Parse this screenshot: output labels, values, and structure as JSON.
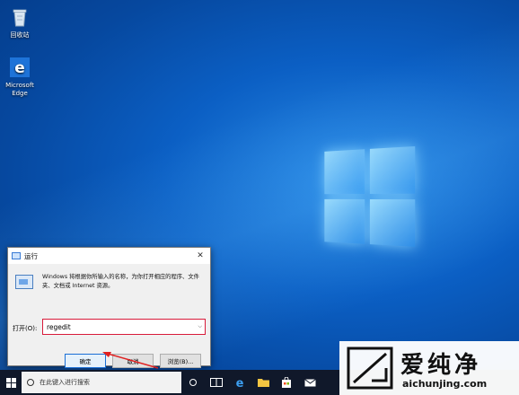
{
  "desktop": {
    "icons": [
      {
        "label": "回收站",
        "icon": "recycle-bin-icon"
      },
      {
        "label": "Microsoft Edge",
        "icon": "edge-icon"
      }
    ]
  },
  "run_dialog": {
    "title": "运行",
    "description": "Windows 将根据你所输入的名称，为你打开相应的程序、文件夹、文档或 Internet 资源。",
    "open_label": "打开(O):",
    "input_value": "regedit",
    "ok_label": "确定",
    "cancel_label": "取消",
    "browse_label": "浏览(B)..."
  },
  "taskbar": {
    "search_placeholder": "在此键入进行搜索"
  },
  "watermark": {
    "title": "爱纯净",
    "url": "aichunjing.com"
  },
  "colors": {
    "highlight": "#d81b3a",
    "accent": "#1a6fd6"
  }
}
